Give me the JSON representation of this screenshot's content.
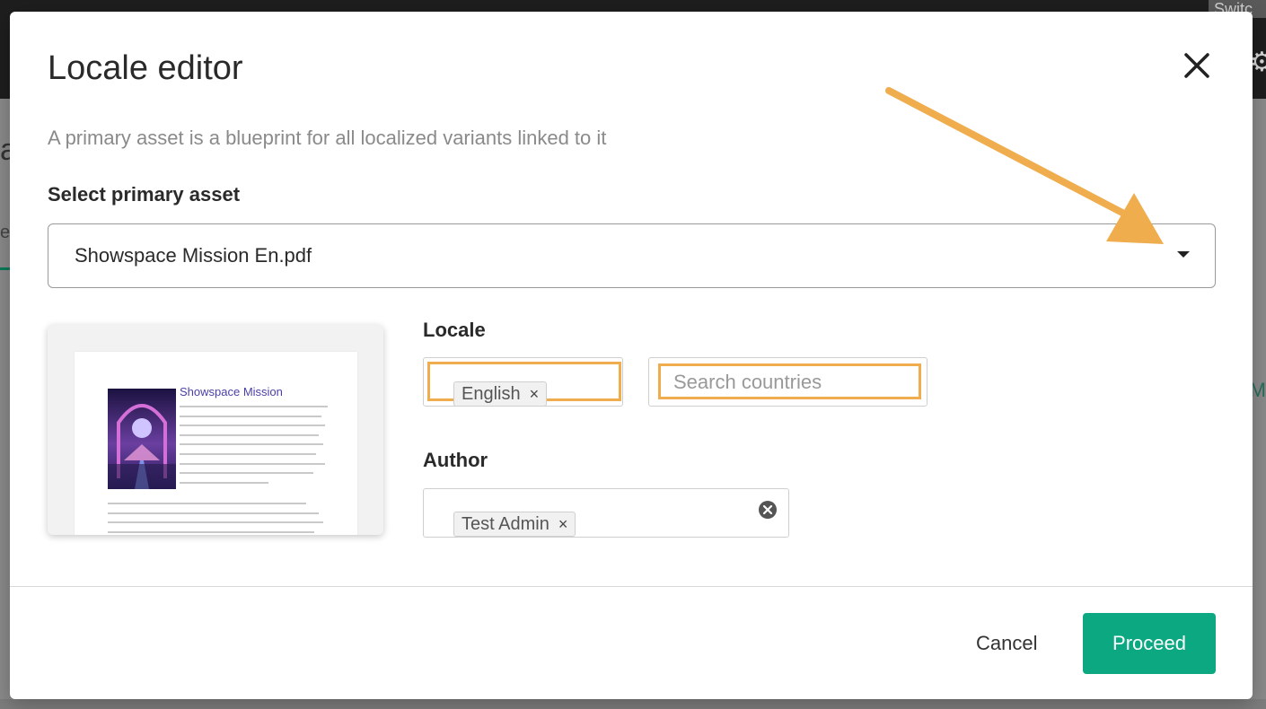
{
  "background": {
    "switch_label": "Switc",
    "left_fragment_a": "a",
    "left_fragment_tab": "er",
    "right_fragment": "M"
  },
  "modal": {
    "title": "Locale editor",
    "subtitle": "A primary asset is a blueprint for all localized variants linked to it",
    "primary_asset_label": "Select primary asset",
    "primary_asset_value": "Showspace Mission En.pdf",
    "preview": {
      "doc_title": "Showspace Mission"
    },
    "locale": {
      "label": "Locale",
      "selected_chip": "English",
      "country_placeholder": "Search countries"
    },
    "author": {
      "label": "Author",
      "selected_chip": "Test Admin"
    },
    "footer": {
      "cancel_label": "Cancel",
      "proceed_label": "Proceed"
    }
  },
  "colors": {
    "accent": "#0ba882",
    "annotation": "#f0ad4e",
    "doc_title": "#4a3fa8"
  },
  "icons": [
    "close-icon",
    "chevron-down-icon",
    "clear-icon",
    "remove-chip-icon",
    "gear-icon",
    "annotation-arrow"
  ]
}
